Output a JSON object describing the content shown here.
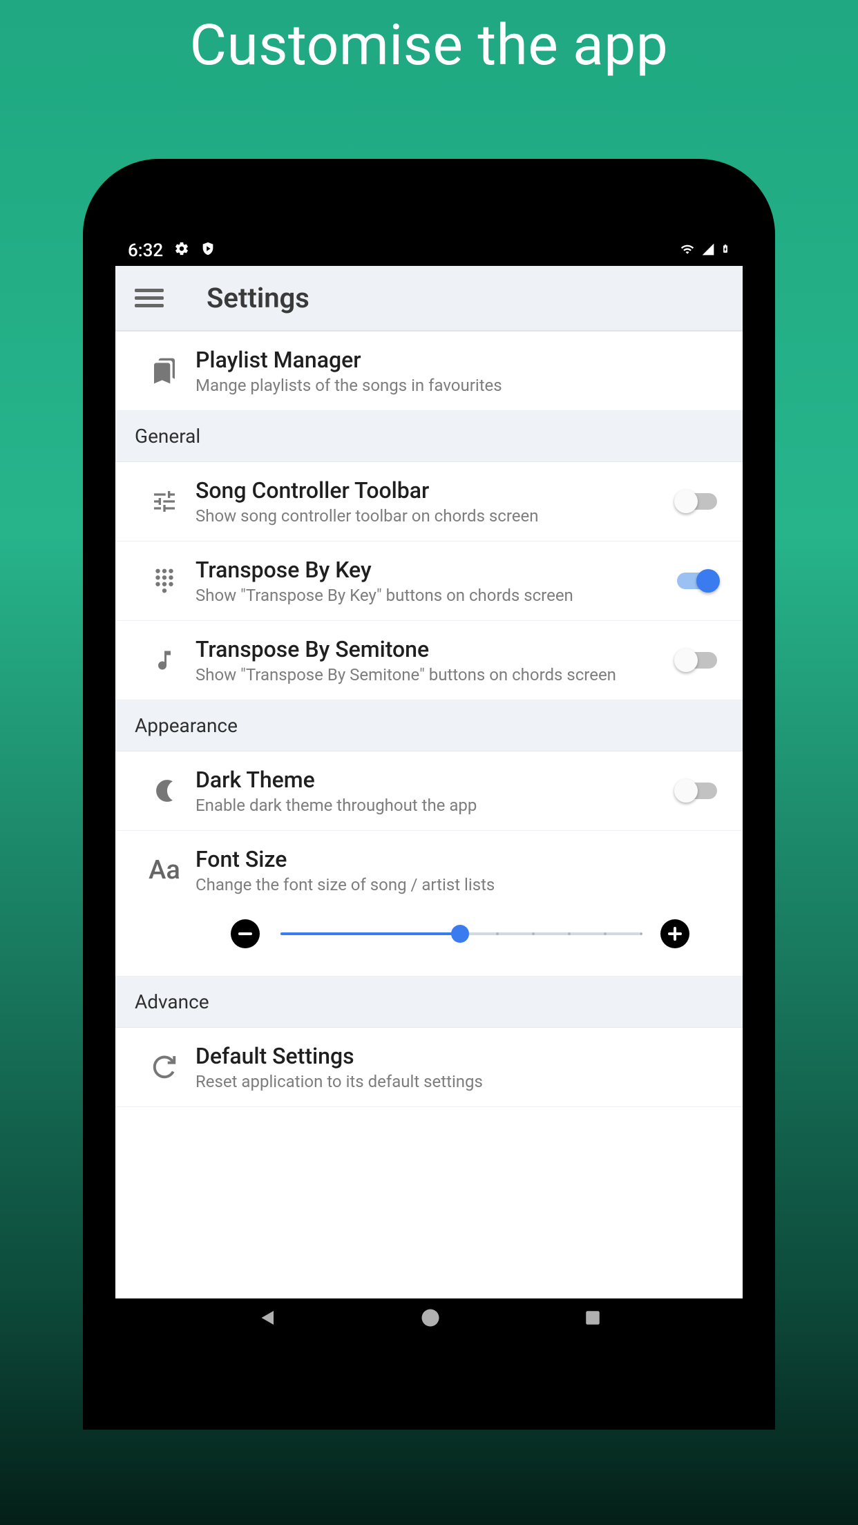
{
  "promo": {
    "title": "Customise the app"
  },
  "statusbar": {
    "time": "6:32"
  },
  "appbar": {
    "title": "Settings"
  },
  "playlist": {
    "title": "Playlist Manager",
    "sub": "Mange playlists of the songs in favourites"
  },
  "sections": {
    "general": "General",
    "appearance": "Appearance",
    "advance": "Advance"
  },
  "songController": {
    "title": "Song Controller Toolbar",
    "sub": "Show song controller toolbar on chords screen",
    "on": false
  },
  "transposeKey": {
    "title": "Transpose By Key",
    "sub": "Show \"Transpose By Key\" buttons on chords screen",
    "on": true
  },
  "transposeSemitone": {
    "title": "Transpose By Semitone",
    "sub": "Show \"Transpose By Semitone\" buttons on chords screen",
    "on": false
  },
  "darkTheme": {
    "title": "Dark Theme",
    "sub": "Enable dark theme throughout the app",
    "on": false
  },
  "fontSize": {
    "title": "Font Size",
    "sub": "Change the font size of song / artist lists",
    "value": 5,
    "min": 0,
    "max": 10
  },
  "defaultSettings": {
    "title": "Default Settings",
    "sub": "Reset application to its default settings"
  }
}
